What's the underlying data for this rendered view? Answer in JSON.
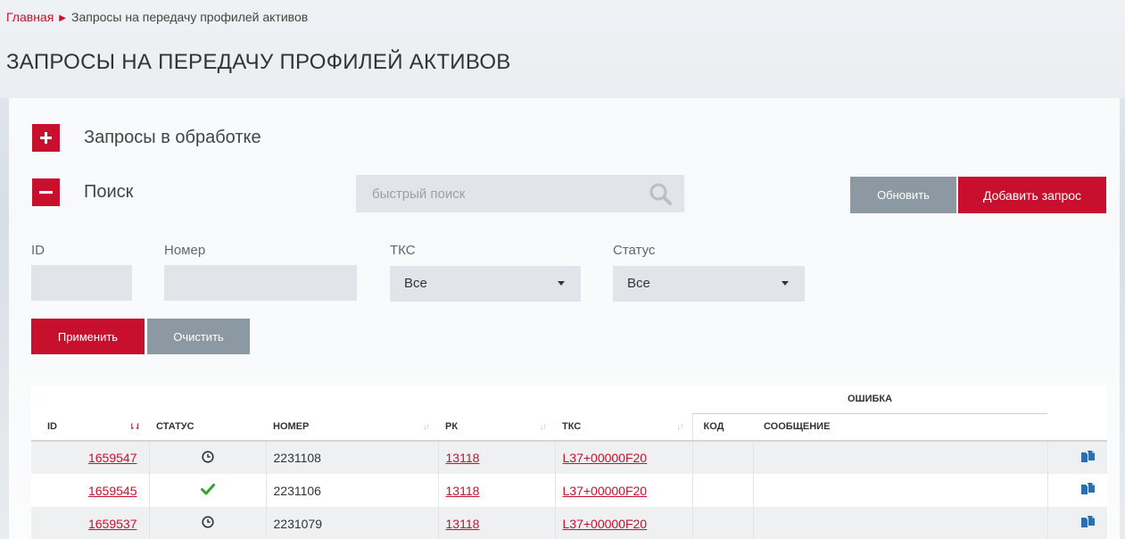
{
  "breadcrumb": {
    "home": "Главная",
    "current": "Запросы на передачу профилей активов"
  },
  "page_title": "ЗАПРОСЫ НА ПЕРЕДАЧУ ПРОФИЛЕЙ АКТИВОВ",
  "sections": {
    "processing": {
      "label": "Запросы в обработке",
      "toggle": "+"
    },
    "search": {
      "label": "Поиск",
      "toggle": "−"
    }
  },
  "quick_search": {
    "placeholder": "быстрый поиск",
    "value": ""
  },
  "actions": {
    "refresh": "Обновить",
    "add": "Добавить запрос"
  },
  "filters": {
    "id_label": "ID",
    "number_label": "Номер",
    "tks_label": "ТКС",
    "tks_value": "Все",
    "status_label": "Статус",
    "status_value": "Все",
    "apply": "Применить",
    "clear": "Очистить"
  },
  "table": {
    "group_header": "ОШИБКА",
    "columns": [
      "ID",
      "СТАТУС",
      "НОМЕР",
      "РК",
      "ТКС",
      "КОД",
      "СООБЩЕНИЕ"
    ],
    "rows": [
      {
        "id": "1659547",
        "status": "pending",
        "number": "2231108",
        "rk": "13118",
        "tks": "L37+00000F20",
        "code": "",
        "message": ""
      },
      {
        "id": "1659545",
        "status": "done",
        "number": "2231106",
        "rk": "13118",
        "tks": "L37+00000F20",
        "code": "",
        "message": ""
      },
      {
        "id": "1659537",
        "status": "pending",
        "number": "2231079",
        "rk": "13118",
        "tks": "L37+00000F20",
        "code": "",
        "message": ""
      }
    ]
  },
  "colors": {
    "accent": "#c8102e",
    "gray_button": "#8c98a2",
    "success": "#2aa52a"
  },
  "icons": {
    "search": "search-icon",
    "pending": "clock-icon",
    "done": "checkmark-icon",
    "copy": "copy-icon"
  }
}
